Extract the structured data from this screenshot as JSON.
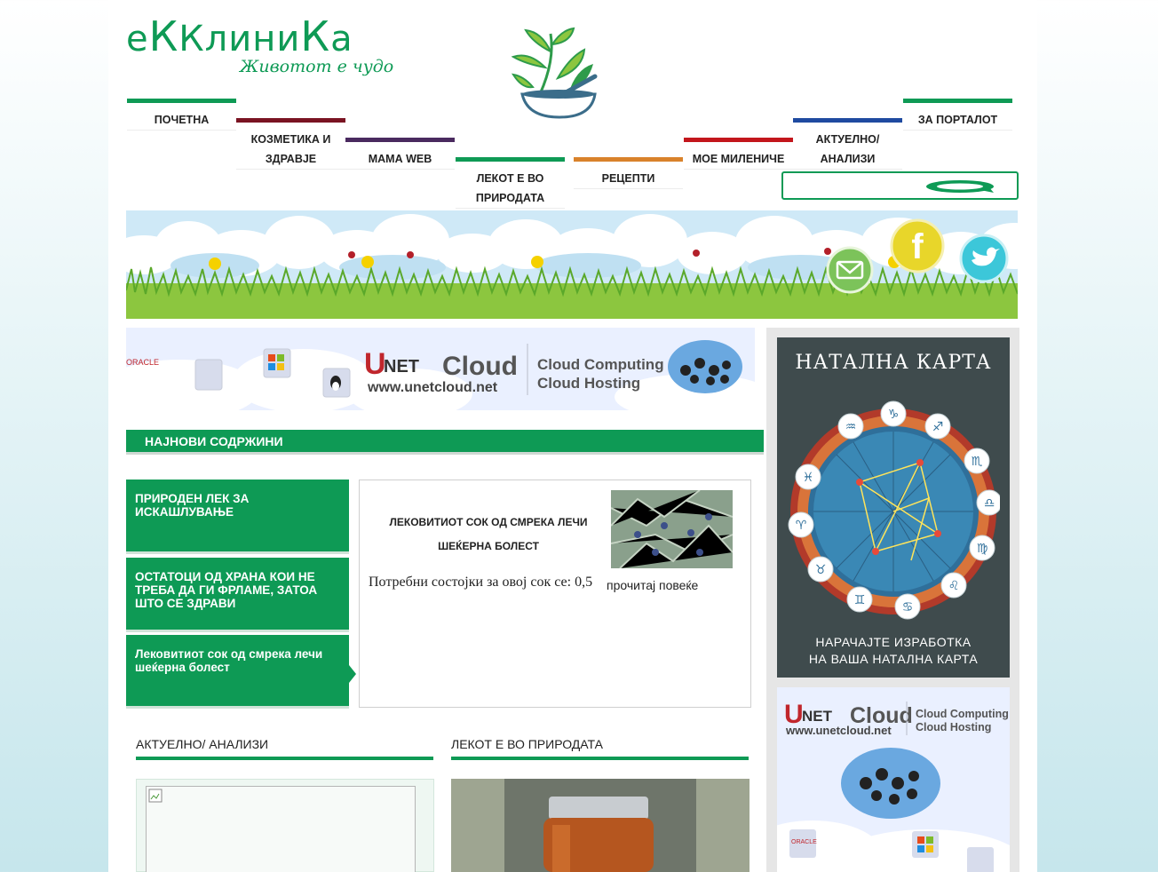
{
  "logo": {
    "title_prefix": "е",
    "title_mid": "Клини",
    "title_k": "К",
    "title_suffix": "а",
    "tagline": "Животот е чудо"
  },
  "nav": [
    {
      "label": "ПОЧЕТНА",
      "color": "#0e9a55"
    },
    {
      "label": "КОЗМЕТИКА И ЗДРАВЈЕ",
      "color": "#7a1322"
    },
    {
      "label": "МАМА WEB",
      "color": "#4a2a5f"
    },
    {
      "label": "ЛЕКОТ Е ВО ПРИРОДАТА",
      "color": "#0e9a55"
    },
    {
      "label": "РЕЦЕПТИ",
      "color": "#d9822b"
    },
    {
      "label": "МОЕ МИЛЕНИЧЕ",
      "color": "#c3161c"
    },
    {
      "label": "АКТУЕЛНО/ АНАЛИЗИ",
      "color": "#1f4aa0"
    },
    {
      "label": "ЗА ПОРТАЛОТ",
      "color": "#0e9a55"
    }
  ],
  "search": {
    "placeholder": ""
  },
  "ad1": {
    "brand_u": "U",
    "brand_net": "NET",
    "brand_cloud": "Cloud",
    "url": "www.unetcloud.net",
    "line1": "Cloud Computing",
    "line2": "Cloud Hosting",
    "oracle": "ORACLE"
  },
  "latest": {
    "heading": "НАЈНОВИ СОДРЖИНИ",
    "tabs": [
      "ПРИРОДЕН ЛЕК ЗА ИСКАШЛУВАЊЕ",
      "ОСТАТОЦИ ОД ХРАНА КОИ НЕ ТРЕБА ДА ГИ ФРЛАМЕ, ЗАТОА ШТО СЕ ЗДРАВИ",
      "Лековитиот сок од смрека лечи шеќерна болест"
    ],
    "article": {
      "title": "ЛЕКОВИТИОТ СОК ОД СМРЕКА ЛЕЧИ ШЕЌЕРНА БОЛЕСТ",
      "text": "Потребни состојки за овој сок се: 0,5",
      "more": "прочитај повеќе"
    }
  },
  "sections": [
    "АКТУЕЛНО/ АНАЛИЗИ",
    "ЛЕКОТ Е ВО ПРИРОДАТА"
  ],
  "sidebar": {
    "natal_title": "НАТАЛНА КАРТА",
    "natal_line1": "НАРАЧАЈТЕ ИЗРАБОТКА",
    "natal_line2": "НА ВАША НАТАЛНА КАРТА",
    "ad2": {
      "brand_u": "U",
      "brand_net": "NET",
      "brand_cloud": "Cloud",
      "url": "www.unetcloud.net",
      "line1": "Cloud Computing",
      "line2": "Cloud Hosting",
      "oracle": "ORACLE"
    }
  },
  "colors": {
    "brand": "#0e9a55"
  }
}
